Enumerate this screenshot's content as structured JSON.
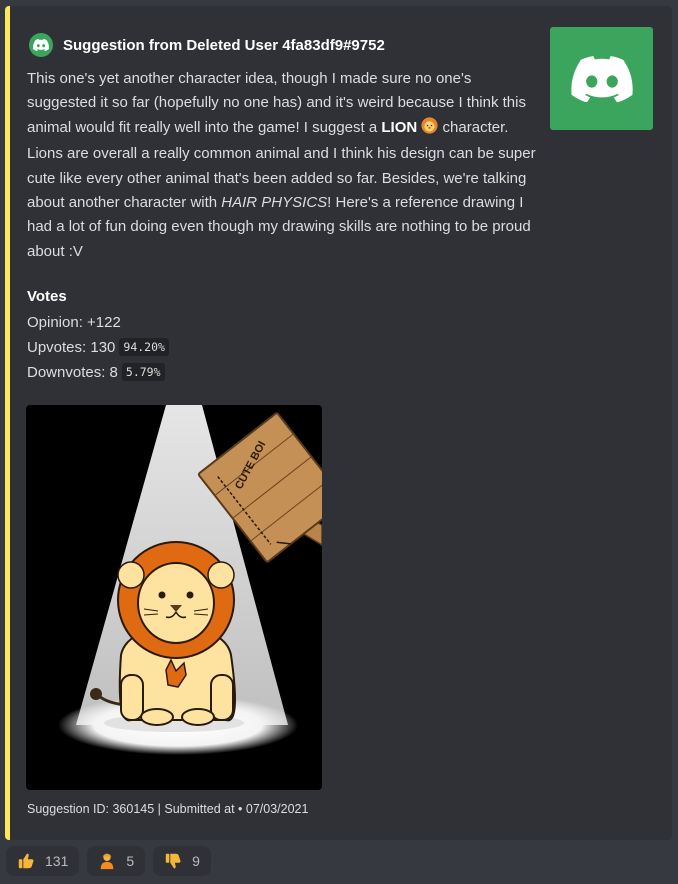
{
  "embed": {
    "author": "Suggestion from Deleted User 4fa83df9#9752",
    "description": {
      "p1": "This one's yet another character idea, though I made sure no one's suggested it so far (hopefully no one has) and it's weird because I think this animal would fit really well into the game! I suggest a ",
      "bold": "LION",
      "p2": " character. Lions are overall a really common animal and I think his design can be super cute like every other animal that's been added so far. Besides, we're talking about another character with ",
      "italic": "HAIR PHYSICS",
      "p3": "! Here's a reference drawing I had a lot of fun doing even though my drawing skills are nothing to be proud about :V"
    },
    "votes_title": "Votes",
    "opinion": "Opinion: +122",
    "upvotes_label": "Upvotes: 130",
    "upvotes_pct": "94.20%",
    "downvotes_label": "Downvotes: 8",
    "downvotes_pct": "5.79%",
    "sign_text": "CUTE BOI",
    "footer": "Suggestion ID: 360145 | Submitted at • 07/03/2021",
    "accent_color": "#fee75c",
    "thumb_color": "#3ba55d"
  },
  "reactions": [
    {
      "icon": "thumbs-up-icon",
      "count": "131"
    },
    {
      "icon": "person-icon",
      "count": "5"
    },
    {
      "icon": "thumbs-down-icon",
      "count": "9"
    }
  ]
}
